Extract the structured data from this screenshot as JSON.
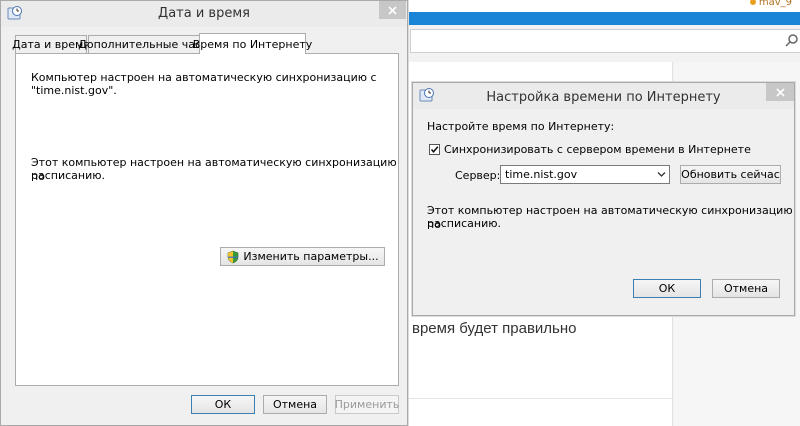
{
  "background": {
    "user_text": "mav_9",
    "content_text": "время будет правильно"
  },
  "datetime_dialog": {
    "title": "Дата и время",
    "tabs": [
      {
        "label": "Дата и время"
      },
      {
        "label": "Дополнительные часы"
      },
      {
        "label": "Время по Интернету"
      }
    ],
    "active_tab": "Время по Интернету",
    "status_line1": "Компьютер настроен на автоматическую синхронизацию с",
    "status_line2": "\"time.nist.gov\".",
    "schedule_line1": "Этот компьютер настроен на автоматическую синхронизацию по",
    "schedule_line2": "расписанию.",
    "change_button": "Изменить параметры...",
    "ok_button": "ОК",
    "cancel_button": "Отмена",
    "apply_button": "Применить"
  },
  "internet_time_dialog": {
    "title": "Настройка времени по Интернету",
    "heading": "Настройте время по Интернету:",
    "sync_checkbox_label": "Синхронизировать с сервером времени в Интернете",
    "sync_checked": true,
    "server_label": "Сервер:",
    "server_value": "time.nist.gov",
    "update_button": "Обновить сейчас",
    "info_line1": "Этот компьютер настроен на автоматическую синхронизацию по",
    "info_line2": "расписанию.",
    "ok_button": "ОК",
    "cancel_button": "Отмена"
  },
  "colors": {
    "accent_bar": "#1a85d6",
    "dialog_bg": "#f0f0f0"
  }
}
